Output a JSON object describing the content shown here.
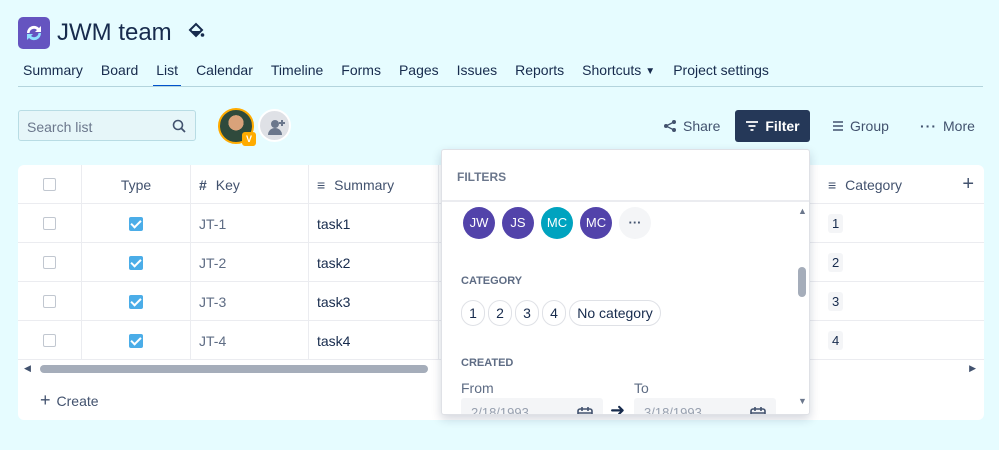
{
  "project": {
    "title": "JWM team",
    "icon": "project-sync-icon",
    "theme_icon": "paint-bucket-icon"
  },
  "tabs": [
    {
      "label": "Summary"
    },
    {
      "label": "Board"
    },
    {
      "label": "List",
      "active": true
    },
    {
      "label": "Calendar"
    },
    {
      "label": "Timeline"
    },
    {
      "label": "Forms"
    },
    {
      "label": "Pages"
    },
    {
      "label": "Issues"
    },
    {
      "label": "Reports"
    },
    {
      "label": "Shortcuts"
    },
    {
      "label": "Project settings"
    }
  ],
  "toolbar": {
    "search_placeholder": "Search list",
    "avatar_badge": "V",
    "share_label": "Share",
    "filter_label": "Filter",
    "group_label": "Group",
    "more_label": "More"
  },
  "table": {
    "headers": {
      "type": "Type",
      "key": "Key",
      "summary": "Summary",
      "category": "Category"
    },
    "rows": [
      {
        "key": "JT-1",
        "summary": "task1",
        "category": "1"
      },
      {
        "key": "JT-2",
        "summary": "task2",
        "category": "2"
      },
      {
        "key": "JT-3",
        "summary": "task3",
        "category": "3"
      },
      {
        "key": "JT-4",
        "summary": "task4",
        "category": "4"
      }
    ],
    "create_label": "Create"
  },
  "filter_panel": {
    "title": "FILTERS",
    "assignees": [
      {
        "initials": "JW",
        "color": "#5243aa"
      },
      {
        "initials": "JS",
        "color": "#5243aa"
      },
      {
        "initials": "MC",
        "color": "#00a3bf"
      },
      {
        "initials": "MC",
        "color": "#5243aa"
      },
      {
        "initials": "···",
        "color": "#f4f5f7"
      }
    ],
    "category_heading": "CATEGORY",
    "categories": [
      "1",
      "2",
      "3",
      "4",
      "No category"
    ],
    "created_heading": "CREATED",
    "from_label": "From",
    "to_label": "To",
    "from_value": "2/18/1993",
    "to_value": "3/18/1993"
  },
  "colors": {
    "accent": "#0052cc",
    "filter_button": "#253858",
    "page_bg": "#e6fcff",
    "project_icon": "#6554c0"
  }
}
